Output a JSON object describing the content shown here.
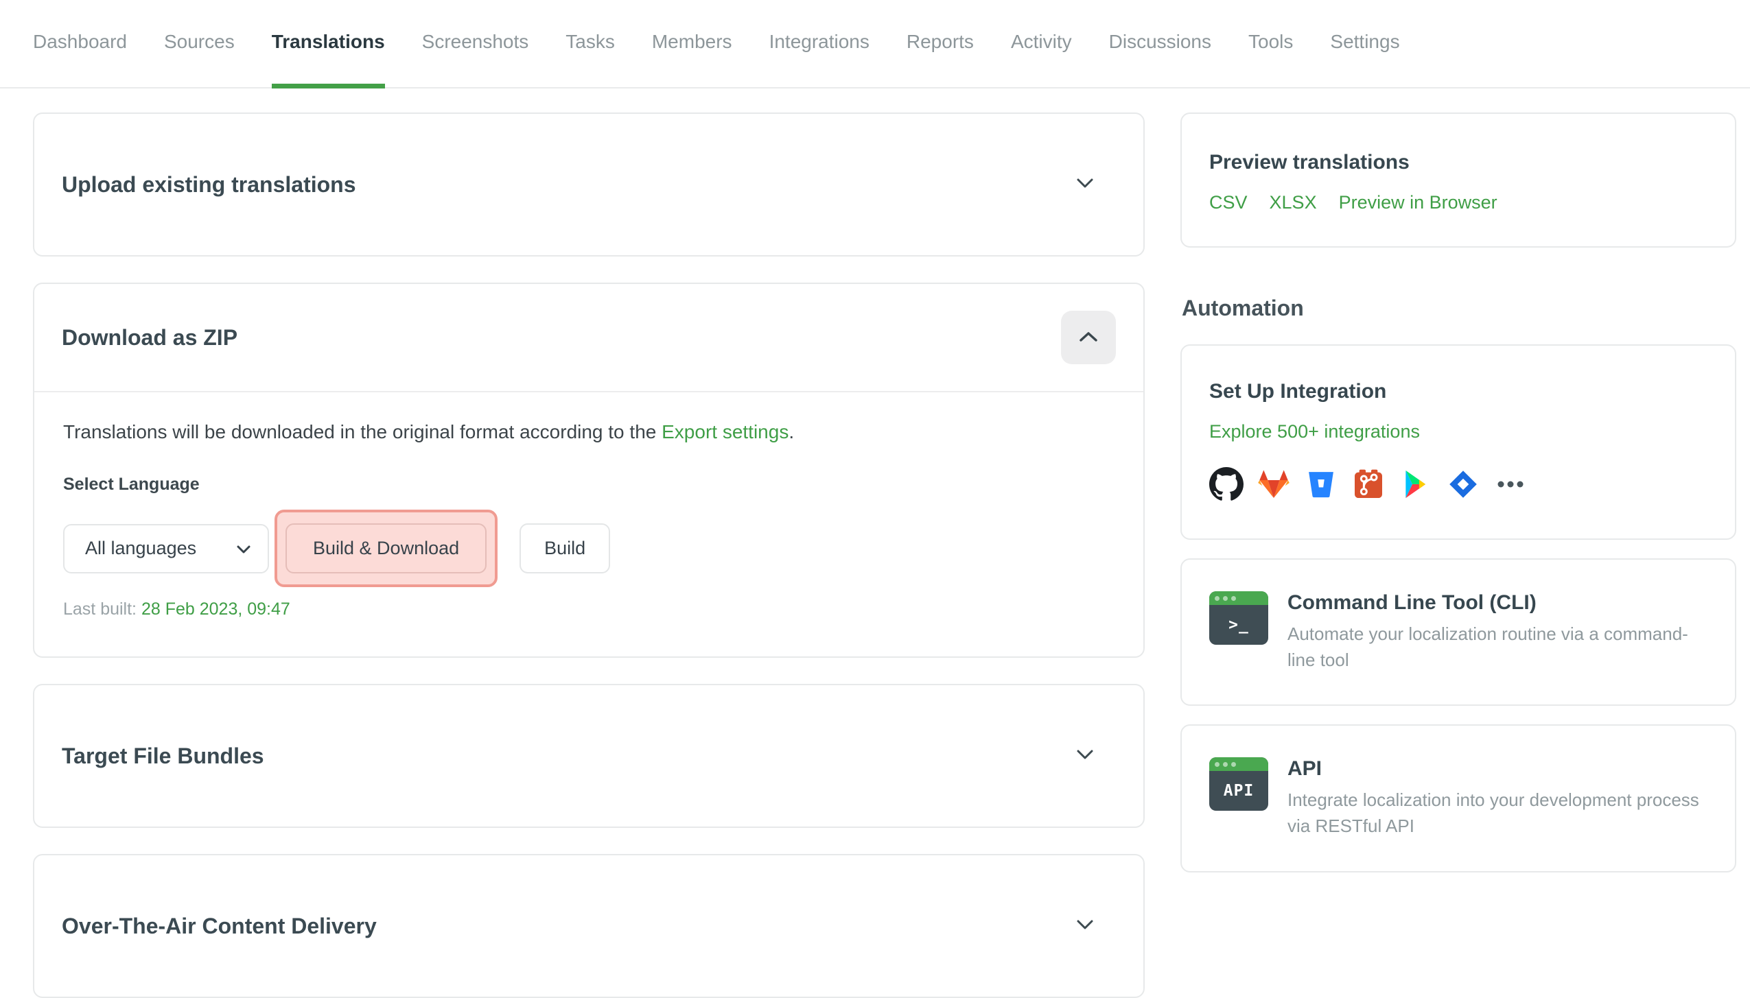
{
  "nav": {
    "items": [
      {
        "label": "Dashboard",
        "active": false
      },
      {
        "label": "Sources",
        "active": false
      },
      {
        "label": "Translations",
        "active": true
      },
      {
        "label": "Screenshots",
        "active": false
      },
      {
        "label": "Tasks",
        "active": false
      },
      {
        "label": "Members",
        "active": false
      },
      {
        "label": "Integrations",
        "active": false
      },
      {
        "label": "Reports",
        "active": false
      },
      {
        "label": "Activity",
        "active": false
      },
      {
        "label": "Discussions",
        "active": false
      },
      {
        "label": "Tools",
        "active": false
      },
      {
        "label": "Settings",
        "active": false
      }
    ]
  },
  "main": {
    "upload_card": {
      "title": "Upload existing translations",
      "collapse_icon": "chevron-down-icon"
    },
    "download_card": {
      "title": "Download as ZIP",
      "collapse_icon": "chevron-up-icon",
      "description_prefix": "Translations will be downloaded in the original format according to the ",
      "description_link": "Export settings",
      "description_suffix": ".",
      "select_language_label": "Select Language",
      "language_select_value": "All languages",
      "build_download_button": "Build & Download",
      "build_button": "Build",
      "last_built_label": "Last built:",
      "last_built_value": "28 Feb 2023, 09:47"
    },
    "bundles_card": {
      "title": "Target File Bundles",
      "collapse_icon": "chevron-down-icon"
    },
    "ota_card": {
      "title": "Over-The-Air Content Delivery",
      "collapse_icon": "chevron-down-icon"
    }
  },
  "sidebar": {
    "preview": {
      "title": "Preview translations",
      "links": [
        {
          "label": "CSV"
        },
        {
          "label": "XLSX"
        },
        {
          "label": "Preview in Browser"
        }
      ]
    },
    "automation_heading": "Automation",
    "integration": {
      "title": "Set Up Integration",
      "link": "Explore 500+ integrations",
      "icons": [
        "github-icon",
        "gitlab-icon",
        "bitbucket-icon",
        "git-icon",
        "google-play-icon",
        "jira-icon",
        "more-icon"
      ]
    },
    "cli": {
      "title": "Command Line Tool (CLI)",
      "description": "Automate your localization routine via a command-line tool",
      "icon_glyph": ">_"
    },
    "api": {
      "title": "API",
      "description": "Integrate localization into your development process via RESTful API",
      "icon_glyph": "API"
    }
  },
  "colors": {
    "accent_green": "#43a047",
    "link_green": "#3f9e46",
    "highlight_bg": "#fcdbd7",
    "highlight_border": "#f09b91",
    "terminal_green": "#4aa850",
    "terminal_dark": "#3f4d54"
  }
}
